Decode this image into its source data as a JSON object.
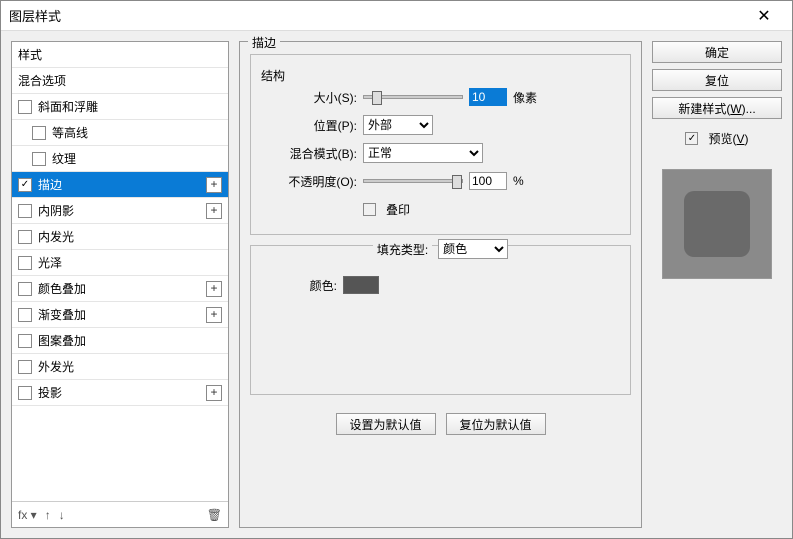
{
  "window": {
    "title": "图层样式"
  },
  "left": {
    "headers": {
      "styles": "样式",
      "blendOptions": "混合选项"
    },
    "items": [
      {
        "label": "斜面和浮雕",
        "checked": false,
        "plus": false,
        "indent": 0
      },
      {
        "label": "等高线",
        "checked": false,
        "plus": false,
        "indent": 1
      },
      {
        "label": "纹理",
        "checked": false,
        "plus": false,
        "indent": 1
      },
      {
        "label": "描边",
        "checked": true,
        "plus": true,
        "indent": 0,
        "selected": true
      },
      {
        "label": "内阴影",
        "checked": false,
        "plus": true,
        "indent": 0
      },
      {
        "label": "内发光",
        "checked": false,
        "plus": false,
        "indent": 0
      },
      {
        "label": "光泽",
        "checked": false,
        "plus": false,
        "indent": 0
      },
      {
        "label": "颜色叠加",
        "checked": false,
        "plus": true,
        "indent": 0
      },
      {
        "label": "渐变叠加",
        "checked": false,
        "plus": true,
        "indent": 0
      },
      {
        "label": "图案叠加",
        "checked": false,
        "plus": false,
        "indent": 0
      },
      {
        "label": "外发光",
        "checked": false,
        "plus": false,
        "indent": 0
      },
      {
        "label": "投影",
        "checked": false,
        "plus": true,
        "indent": 0
      }
    ],
    "footer": {
      "fx": "fx ▾",
      "up": "↑",
      "down": "↓",
      "trash": "🗑"
    }
  },
  "mid": {
    "sectionTitle": "描边",
    "structureTitle": "结构",
    "size": {
      "label": "大小(S):",
      "value": "10",
      "unit": "像素",
      "thumbPct": 8
    },
    "position": {
      "label": "位置(P):",
      "value": "外部"
    },
    "blend": {
      "label": "混合模式(B):",
      "value": "正常"
    },
    "opacity": {
      "label": "不透明度(O):",
      "value": "100",
      "unit": "%",
      "thumbPct": 100
    },
    "overprint": {
      "label": "叠印",
      "checked": false
    },
    "fillType": {
      "label": "填充类型:",
      "value": "颜色"
    },
    "color": {
      "label": "颜色:",
      "hex": "#555555"
    },
    "defaults": {
      "set": "设置为默认值",
      "reset": "复位为默认值"
    }
  },
  "right": {
    "ok": "确定",
    "reset": "复位",
    "newStyle": "新建样式(W)...",
    "preview": {
      "label": "预览(V)",
      "checked": true
    }
  }
}
